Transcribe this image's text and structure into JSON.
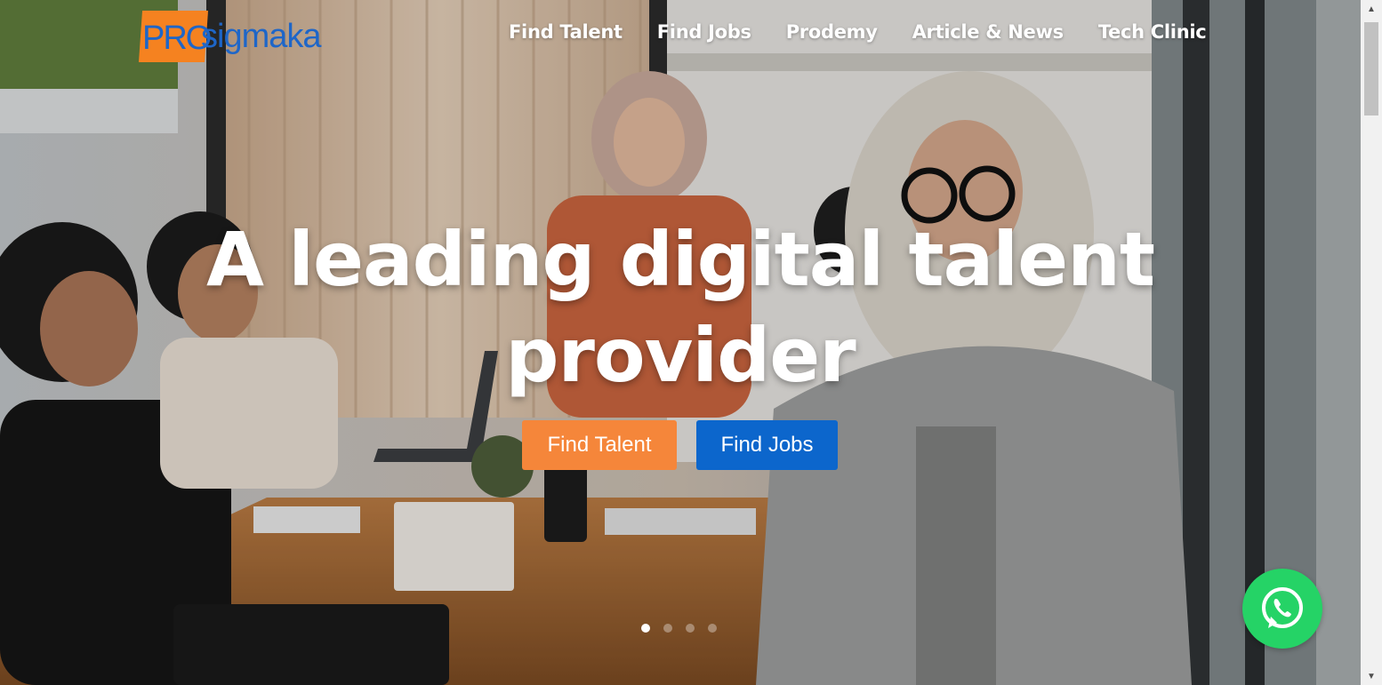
{
  "brand": {
    "logo_part1": "PRO",
    "logo_part2": "sigmaka",
    "logo_bg_color": "#f58220",
    "logo_text_color": "#1e66c8"
  },
  "nav": {
    "items": [
      {
        "label": "Find Talent"
      },
      {
        "label": "Find Jobs"
      },
      {
        "label": "Prodemy"
      },
      {
        "label": "Article & News"
      },
      {
        "label": "Tech Clinic"
      }
    ]
  },
  "hero": {
    "headline_line1": "A leading digital talent",
    "headline_line2": "provider",
    "buttons": {
      "find_talent": "Find Talent",
      "find_jobs": "Find Jobs"
    },
    "button_colors": {
      "find_talent": "#f5863a",
      "find_jobs": "#0c66cc"
    },
    "background_image": "office meeting photo"
  },
  "carousel": {
    "slide_count": 4,
    "active_index": 0
  },
  "whatsapp": {
    "icon": "whatsapp-icon",
    "color": "#25d366"
  }
}
